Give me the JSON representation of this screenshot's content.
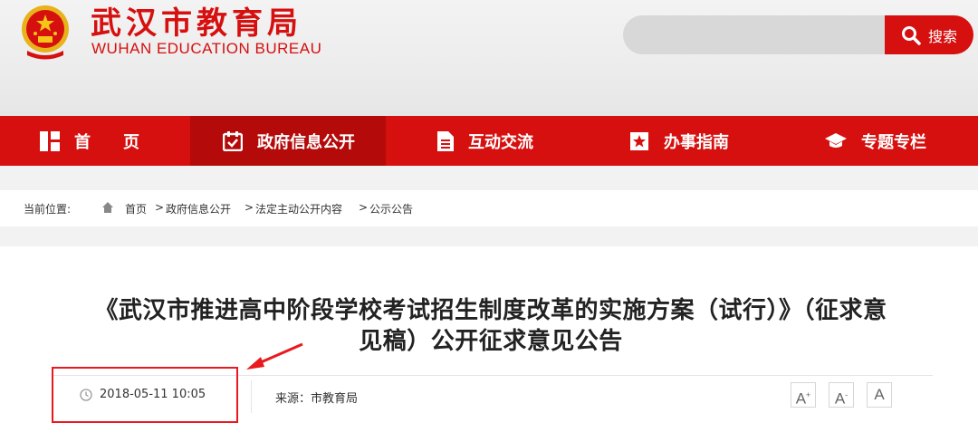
{
  "header": {
    "site_title": "武汉市教育局",
    "site_subtitle": "WUHAN EDUCATION BUREAU",
    "search_placeholder": "",
    "search_label": "搜索"
  },
  "nav": {
    "items": [
      {
        "label": "首　　页",
        "icon": "home-grid-icon"
      },
      {
        "label": "政府信息公开",
        "icon": "calendar-check-icon",
        "active": true
      },
      {
        "label": "互动交流",
        "icon": "document-icon"
      },
      {
        "label": "办事指南",
        "icon": "star-bookmark-icon"
      },
      {
        "label": "专题专栏",
        "icon": "graduation-cap-icon"
      }
    ]
  },
  "breadcrumb": {
    "prefix": "当前位置:",
    "items": [
      "首页",
      "政府信息公开",
      "法定主动公开内容",
      "公示公告"
    ],
    "separator": ">"
  },
  "article": {
    "title_line1": "《武汉市推进高中阶段学校考试招生制度改革的实施方案（试行）》（征求意",
    "title_line2": "见稿）公开征求意见公告",
    "date": "2018-05-11 10:05",
    "source": "来源：市教育局",
    "font_buttons": {
      "increase": "A",
      "increase_mark": "+",
      "decrease": "A",
      "decrease_mark": "-",
      "reset": "A"
    }
  },
  "colors": {
    "brand_red": "#d60f0f",
    "nav_active": "#b40a0a",
    "annotation_red": "#e8191f"
  }
}
